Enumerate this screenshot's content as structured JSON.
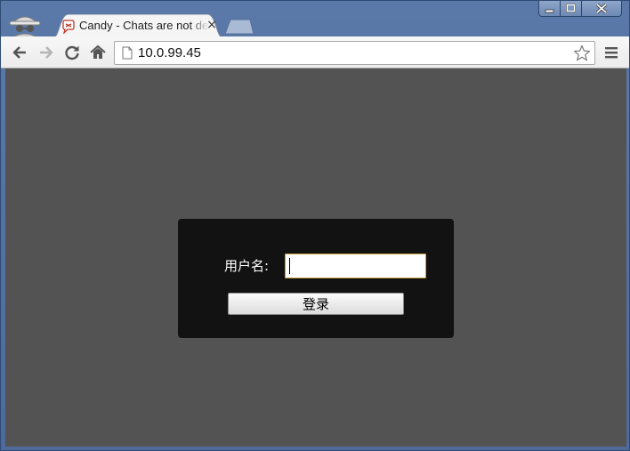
{
  "browser": {
    "tab": {
      "title": "Candy - Chats are not dead yet",
      "close": "×",
      "favicon": "candy-chat-icon"
    },
    "address_bar": {
      "url": "10.0.99.45"
    },
    "icons": {
      "back": "back-arrow-icon",
      "forward": "forward-arrow-icon",
      "reload": "reload-icon",
      "home": "home-icon",
      "bookmark": "star-icon",
      "menu": "menu-icon",
      "incognito": "incognito-icon"
    }
  },
  "login": {
    "username_label": "用户名:",
    "username_value": "",
    "submit_label": "登录"
  },
  "colors": {
    "frame": "#4d6a9a",
    "page_background": "#535353",
    "login_panel": "#121212",
    "input_focus_border": "#c8a03c"
  }
}
